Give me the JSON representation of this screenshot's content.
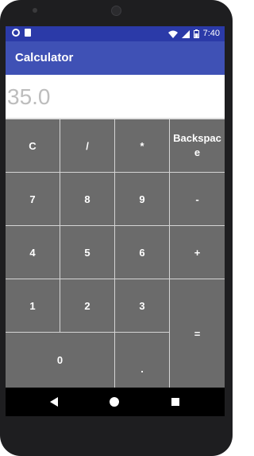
{
  "status_bar": {
    "time": "7:40",
    "icons": [
      "circle-icon",
      "sd-card-icon",
      "wifi-icon",
      "signal-icon",
      "battery-icon"
    ]
  },
  "app_bar": {
    "title": "Calculator"
  },
  "display": {
    "value": "35.0"
  },
  "keys": {
    "clear": "C",
    "divide": "/",
    "multiply": "*",
    "backspace": "Backspace",
    "seven": "7",
    "eight": "8",
    "nine": "9",
    "minus": "-",
    "four": "4",
    "five": "5",
    "six": "6",
    "plus": "+",
    "one": "1",
    "two": "2",
    "three": "3",
    "equals": "=",
    "zero": "0",
    "dot": "."
  },
  "nav_bar": {
    "icons": [
      "back-icon",
      "home-icon",
      "recents-icon"
    ]
  },
  "colors": {
    "status_bar": "#2b3aa8",
    "app_bar": "#3f51b5",
    "key_background": "#6b6b6b",
    "display_text": "#bdbdbd"
  }
}
